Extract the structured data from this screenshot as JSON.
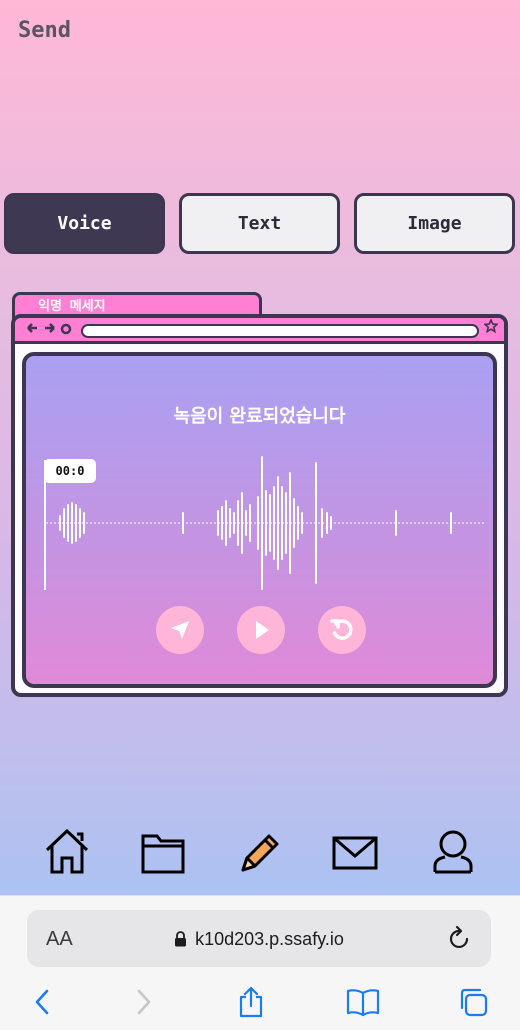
{
  "header": {
    "title": "Send"
  },
  "tabs": [
    {
      "label": "Voice",
      "active": true
    },
    {
      "label": "Text",
      "active": false
    },
    {
      "label": "Image",
      "active": false
    }
  ],
  "window": {
    "tab_label": "익명 메세지",
    "status_text": "녹음이 완료되었습니다",
    "time": "00:0"
  },
  "controls": [
    {
      "name": "send",
      "icon": "send-icon"
    },
    {
      "name": "play",
      "icon": "play-icon"
    },
    {
      "name": "reset",
      "icon": "reset-icon"
    }
  ],
  "bottom_nav": [
    {
      "name": "home",
      "icon": "home-icon"
    },
    {
      "name": "folder",
      "icon": "folder-icon"
    },
    {
      "name": "pencil",
      "icon": "pencil-icon"
    },
    {
      "name": "mail",
      "icon": "mail-icon"
    },
    {
      "name": "profile",
      "icon": "profile-icon"
    }
  ],
  "browser": {
    "text_size_label": "AA",
    "url": "k10d203.p.ssafy.io"
  },
  "colors": {
    "accent_dark": "#3f3853",
    "window_pink": "#ff7fd4",
    "control_pink": "#ffb5d8"
  }
}
